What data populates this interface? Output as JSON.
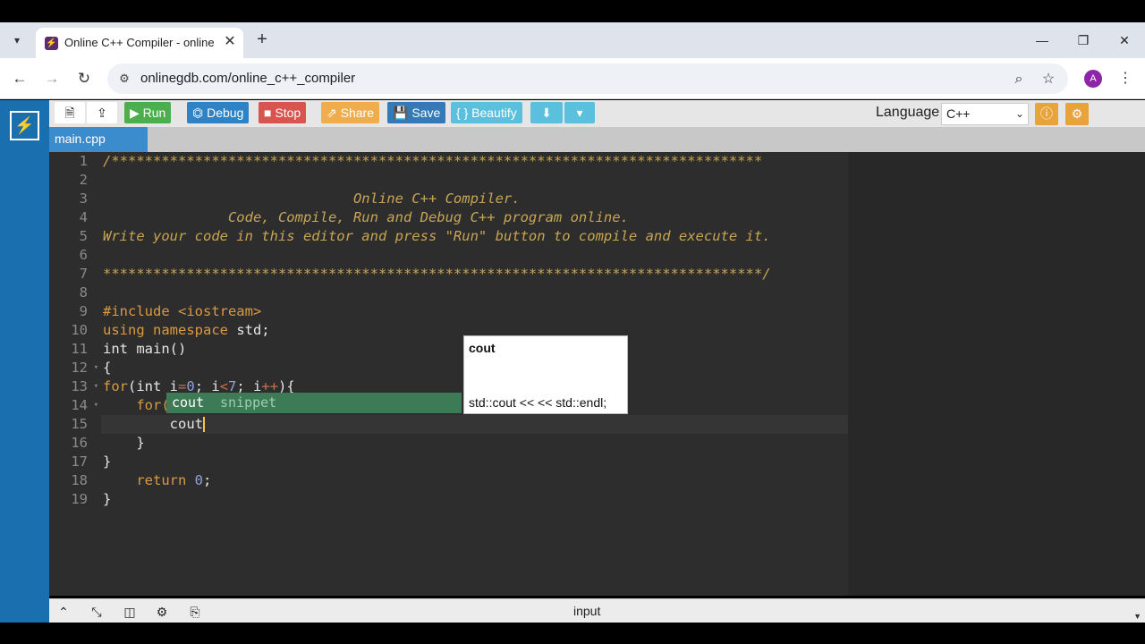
{
  "browser": {
    "tab_title": "Online C++ Compiler - online e",
    "url": "onlinegdb.com/online_c++_compiler",
    "avatar_letter": "A",
    "favicon_glyph": "⚡"
  },
  "app": {
    "toolbar": {
      "run": "Run",
      "debug": "Debug",
      "stop": "Stop",
      "share": "Share",
      "save": "Save",
      "beautify": "{ } Beautify"
    },
    "language_label": "Language",
    "language_value": "C++",
    "file_tab": "main.cpp",
    "bottom_label": "input",
    "colors": {
      "sidebar": "#1a6fae",
      "run": "#4cae4c",
      "debug": "#2f83c4",
      "stop": "#d9534f",
      "share": "#f0ad4e",
      "save": "#337ab7",
      "beautify": "#5bc0de",
      "download": "#5bc0de",
      "info": "#e8a33b"
    }
  },
  "editor": {
    "line_numbers": [
      "1",
      "2",
      "3",
      "4",
      "5",
      "6",
      "7",
      "8",
      "9",
      "10",
      "11",
      "12",
      "13",
      "14",
      "15",
      "16",
      "17",
      "18",
      "19"
    ],
    "lines": {
      "l1": "/******************************************************************************",
      "l3": "                              Online C++ Compiler.",
      "l4": "               Code, Compile, Run and Debug C++ program online.",
      "l5": "Write your code in this editor and press \"Run\" button to compile and execute it.",
      "l7": "*******************************************************************************/",
      "l9_kw": "#include",
      "l9_inc": " <iostream>",
      "l10_kw": "using namespace",
      "l10_rest": " std;",
      "l11": "int main()",
      "l12": "{",
      "l13_kw": "for",
      "l13_a": "(int i",
      "l13_op1": "=",
      "l13_n1": "0",
      "l13_b": "; i",
      "l13_op2": "<",
      "l13_n2": "7",
      "l13_c": "; i",
      "l13_op3": "++",
      "l13_d": "){",
      "l14_kw": "    for(",
      "l15": "        cout",
      "l16": "    }",
      "l17": "}",
      "l18_kw": "    return",
      "l18_n": " 0",
      "l18_end": ";",
      "l19": "}"
    }
  },
  "autocomplete": {
    "word": "cout",
    "meta": "snippet",
    "doc_title": "cout",
    "doc_body": "std::cout <<  << std::endl;"
  }
}
